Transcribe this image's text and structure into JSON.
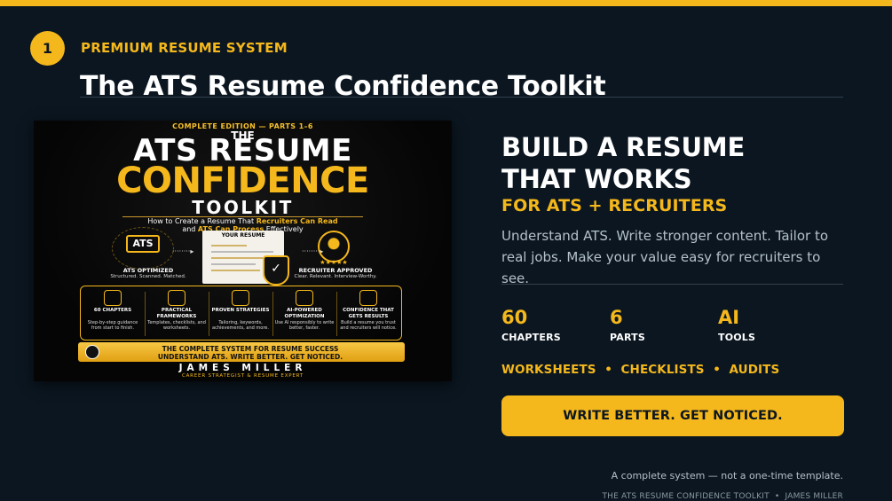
{
  "step": {
    "number": "1"
  },
  "header": {
    "eyebrow": "PREMIUM RESUME SYSTEM",
    "title": "The ATS Resume Confidence Toolkit"
  },
  "cover": {
    "edition": "COMPLETE EDITION — PARTS 1–6",
    "the": "THE",
    "line1": "ATS RESUME",
    "line2": "CONFIDENCE",
    "line3": "TOOLKIT",
    "sub_a": "How to Create a Resume That ",
    "sub_a_hl": "Recruiters Can Read",
    "sub_b": "and ",
    "sub_b_hl": "ATS Can Process",
    "sub_b_end": " Effectively",
    "ats_badge": "ATS",
    "ats_title": "ATS OPTIMIZED",
    "ats_desc": "Structured. Scanned. Matched.",
    "doc_title": "YOUR RESUME",
    "recruiter_title": "RECRUITER APPROVED",
    "recruiter_desc": "Clear. Relevant. Interview-Worthy.",
    "stars": "★★★★★",
    "features": [
      {
        "title": "60 CHAPTERS",
        "desc": "Step-by-step guidance from start to finish."
      },
      {
        "title": "PRACTICAL FRAMEWORKS",
        "desc": "Templates, checklists, and worksheets."
      },
      {
        "title": "PROVEN STRATEGIES",
        "desc": "Tailoring, keywords, achievements, and more."
      },
      {
        "title": "AI-POWERED OPTIMIZATION",
        "desc": "Use AI responsibly to write better, faster."
      },
      {
        "title": "CONFIDENCE THAT GETS RESULTS",
        "desc": "Build a resume you trust and recruiters will notice."
      }
    ],
    "banner_line1": "THE COMPLETE SYSTEM FOR RESUME SUCCESS",
    "banner_line2": "UNDERSTAND ATS. WRITE BETTER. GET NOTICED.",
    "author": "JAMES MILLER",
    "author_role": "CAREER STRATEGIST & RESUME EXPERT"
  },
  "main": {
    "headline_line1": "BUILD A RESUME",
    "headline_line2": "THAT WORKS",
    "accent": "FOR ATS + RECRUITERS",
    "description": "Understand ATS. Write stronger content. Tailor to real jobs. Make your value easy for recruiters to see.",
    "stats": [
      {
        "value": "60",
        "label": "CHAPTERS"
      },
      {
        "value": "6",
        "label": "PARTS"
      },
      {
        "value": "AI",
        "label": "TOOLS"
      }
    ],
    "features_line": "WORKSHEETS  •  CHECKLISTS  •  AUDITS",
    "cta_label": "WRITE BETTER. GET NOTICED.",
    "footnote": "A complete system — not a one-time template.",
    "footer_credit": "THE ATS RESUME CONFIDENCE TOOLKIT  •  JAMES MILLER"
  },
  "colors": {
    "background": "#0b1620",
    "accent": "#f5b81c",
    "muted_text": "#b4c0ca"
  }
}
